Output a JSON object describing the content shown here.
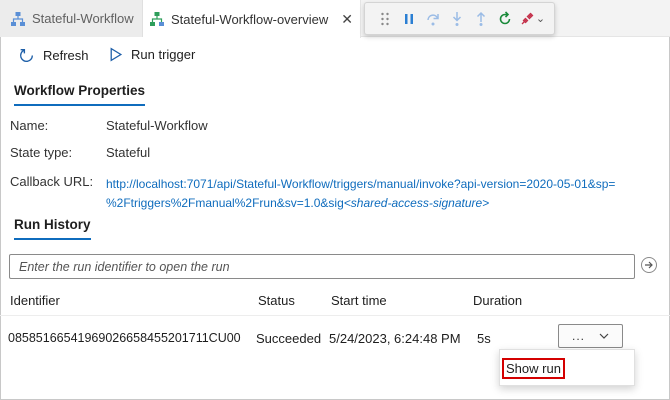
{
  "tabs": [
    {
      "label": "Stateful-Workflow",
      "icon": "workflow-icon"
    },
    {
      "label": "Stateful-Workflow-overview",
      "icon": "workflow-icon",
      "close_glyph": "✕"
    }
  ],
  "debug_toolbar": {
    "buttons": [
      "drag-handle-icon",
      "pause-icon",
      "step-over-icon",
      "step-into-icon",
      "step-out-icon",
      "restart-icon",
      "disconnect-icon"
    ],
    "dropdown_glyph": "⌄"
  },
  "toolbar": {
    "refresh_label": "Refresh",
    "run_trigger_label": "Run trigger"
  },
  "workflow_properties": {
    "title": "Workflow Properties",
    "name_label": "Name:",
    "name_value": "Stateful-Workflow",
    "state_label": "State type:",
    "state_value": "Stateful",
    "callback_label": "Callback URL:",
    "callback_line1": "http://localhost:7071/api/Stateful-Workflow/triggers/manual/invoke?api-version=2020-05-01&sp=",
    "callback_line2": "%2Ftriggers%2Fmanual%2Frun&sv=1.0&sig",
    "callback_sig": "<shared-access-signature>"
  },
  "run_history": {
    "title": "Run History",
    "search_placeholder": "Enter the run identifier to open the run",
    "columns": [
      "Identifier",
      "Status",
      "Start time",
      "Duration"
    ],
    "rows": [
      {
        "identifier": "08585166541969026658455201711CU00",
        "status": "Succeeded",
        "start_time": "5/24/2023, 6:24:48 PM",
        "duration": "5s"
      }
    ],
    "more_label": "...",
    "menu_item": "Show run"
  },
  "colors": {
    "accent": "#0f6cbd",
    "highlight": "#d40000",
    "restart": "#1a8a3a",
    "disconnect": "#c4314b"
  }
}
